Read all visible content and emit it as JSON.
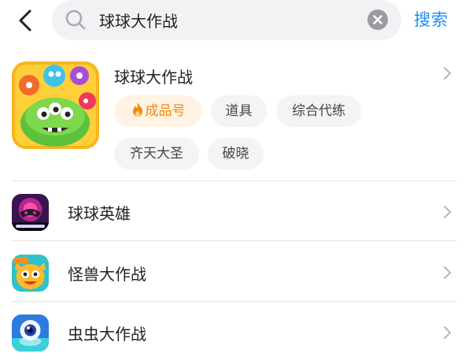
{
  "search": {
    "query": "球球大作战",
    "button_label": "搜索"
  },
  "game": {
    "title": "球球大作战",
    "tags": [
      {
        "label": "成品号",
        "icon": "flame-icon",
        "highlight": true
      },
      {
        "label": "道具"
      },
      {
        "label": "综合代练"
      },
      {
        "label": "齐天大圣"
      },
      {
        "label": "破晓"
      }
    ]
  },
  "suggestions": [
    {
      "label": "球球英雄",
      "icon": "fusion-crush-icon"
    },
    {
      "label": "怪兽大作战",
      "icon": "monster-icon"
    },
    {
      "label": "虫虫大作战",
      "icon": "bug-eye-icon"
    }
  ],
  "colors": {
    "accent": "#1e90f5",
    "hot_tag_text": "#ef8a0e",
    "hot_tag_bg": "#fff3e4"
  }
}
